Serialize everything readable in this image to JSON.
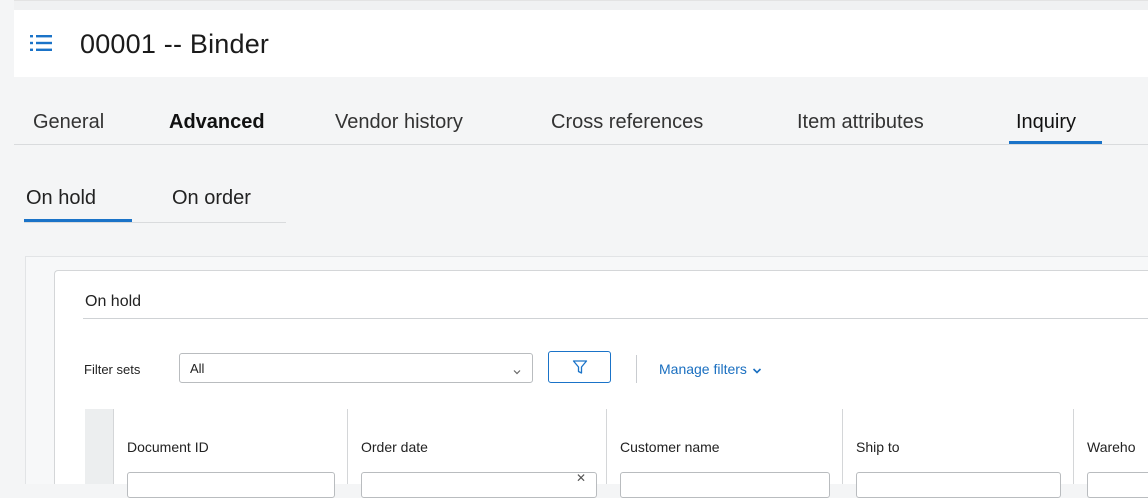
{
  "header": {
    "title": "00001 -- Binder",
    "menu_icon": "list-menu-icon"
  },
  "tabs": [
    {
      "label": "General"
    },
    {
      "label": "Advanced"
    },
    {
      "label": "Vendor history"
    },
    {
      "label": "Cross references"
    },
    {
      "label": "Item attributes"
    },
    {
      "label": "Inquiry",
      "active": true
    }
  ],
  "subtabs": [
    {
      "label": "On hold",
      "active": true
    },
    {
      "label": "On order"
    }
  ],
  "panel": {
    "title": "On hold",
    "filter_sets_label": "Filter sets",
    "filter_sets_value": "All",
    "manage_filters_label": "Manage filters",
    "filter_icon": "funnel-icon"
  },
  "grid": {
    "columns": [
      {
        "label": "Document ID"
      },
      {
        "label": "Order date"
      },
      {
        "label": "Customer name"
      },
      {
        "label": "Ship to"
      },
      {
        "label": "Wareho"
      }
    ]
  },
  "colors": {
    "accent": "#1a73c8",
    "link": "#1a6fc0"
  }
}
